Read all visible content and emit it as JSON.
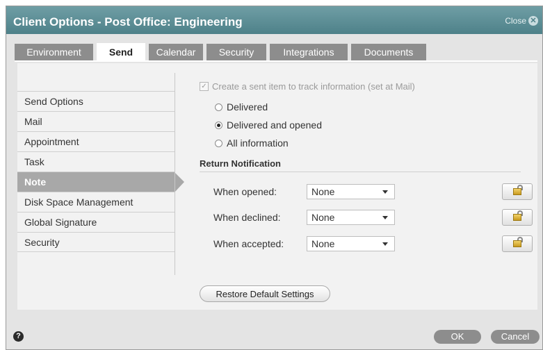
{
  "window": {
    "title": "Client Options - Post Office: Engineering",
    "close_label": "Close",
    "close_glyph": "✕"
  },
  "tabs": [
    {
      "label": "Environment",
      "active": false
    },
    {
      "label": "Send",
      "active": true
    },
    {
      "label": "Calendar",
      "active": false
    },
    {
      "label": "Security",
      "active": false
    },
    {
      "label": "Integrations",
      "active": false
    },
    {
      "label": "Documents",
      "active": false
    }
  ],
  "sidebar": {
    "items": [
      {
        "label": "Send Options"
      },
      {
        "label": "Mail"
      },
      {
        "label": "Appointment"
      },
      {
        "label": "Task"
      },
      {
        "label": "Note",
        "selected": true
      },
      {
        "label": "Disk Space Management"
      },
      {
        "label": "Global Signature"
      },
      {
        "label": "Security"
      }
    ]
  },
  "main": {
    "sent_item_checkbox": {
      "label": "Create a sent item to track information (set at Mail)",
      "checked": true,
      "disabled": true,
      "glyph": "✓"
    },
    "tracking_options": [
      {
        "label": "Delivered",
        "selected": false
      },
      {
        "label": "Delivered and opened",
        "selected": true
      },
      {
        "label": "All information",
        "selected": false
      }
    ],
    "return_notification": {
      "heading": "Return Notification",
      "rows": [
        {
          "label": "When opened:",
          "value": "None"
        },
        {
          "label": "When declined:",
          "value": "None"
        },
        {
          "label": "When accepted:",
          "value": "None"
        }
      ]
    },
    "restore_label": "Restore Default Settings"
  },
  "footer": {
    "help_glyph": "?",
    "ok_label": "OK",
    "cancel_label": "Cancel"
  },
  "colors": {
    "titlebar": "#5b8e96",
    "tab_inactive": "#8d8d8d",
    "selected_nav": "#a8a8a8"
  },
  "icons": {
    "close": "close-icon",
    "checkbox": "checkmark-icon",
    "lock": "padlock-open-icon",
    "dropdown": "chevron-down-icon",
    "help": "help-icon"
  }
}
